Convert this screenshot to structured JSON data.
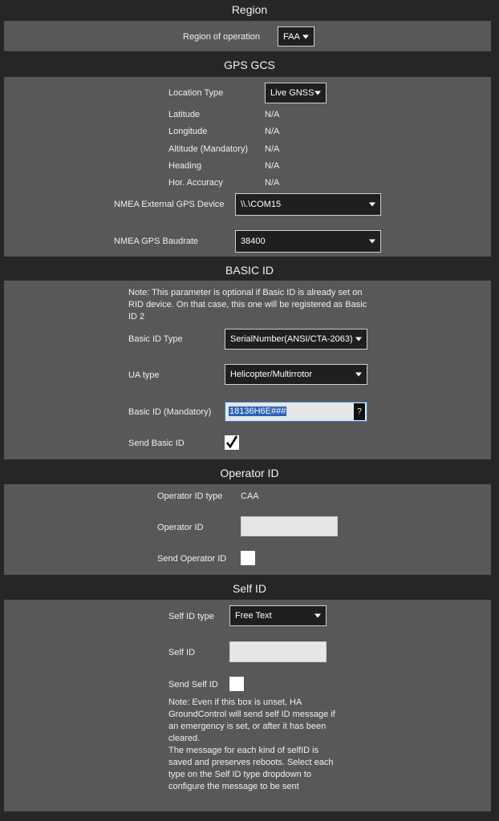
{
  "region": {
    "title": "Region",
    "region_label": "Region of operation",
    "region_value": "FAA"
  },
  "gps": {
    "title": "GPS GCS",
    "location_type_label": "Location Type",
    "location_type_value": "Live GNSS",
    "latitude_label": "Latitude",
    "latitude_value": "N/A",
    "longitude_label": "Longitude",
    "longitude_value": "N/A",
    "altitude_label": "Altitude (Mandatory)",
    "altitude_value": "N/A",
    "heading_label": "Heading",
    "heading_value": "N/A",
    "hacc_label": "Hor. Accuracy",
    "hacc_value": "N/A",
    "nmea_device_label": "NMEA External GPS Device",
    "nmea_device_value": "\\\\.\\COM15",
    "nmea_baud_label": "NMEA GPS Baudrate",
    "nmea_baud_value": "38400"
  },
  "basic_id": {
    "title": "BASIC ID",
    "note": "Note: This parameter is optional if Basic ID is already set on RID device. On that case, this one will be registered as Basic ID 2",
    "type_label": "Basic ID Type",
    "type_value": "SerialNumber(ANSI/CTA-2063)",
    "ua_label": "UA type",
    "ua_value": "Helicopter/Multirrotor",
    "id_label": "Basic ID (Mandatory)",
    "id_value": "18136H6E###",
    "help_label": "?",
    "send_label": "Send Basic ID",
    "send_checked": true
  },
  "operator": {
    "title": "Operator ID",
    "type_label": "Operator ID type",
    "type_value": "CAA",
    "id_label": "Operator ID",
    "id_value": "",
    "send_label": "Send Operator ID",
    "send_checked": false
  },
  "self_id": {
    "title": "Self ID",
    "type_label": "Self ID type",
    "type_value": "Free Text",
    "id_label": "Self ID",
    "id_value": "",
    "send_label": "Send Self ID",
    "send_checked": false,
    "note": "Note: Even if this box is unset, HA GroundControl will send self ID message if an emergency is set, or after it has been cleared.\nThe message for each kind of selfID is saved and preserves reboots. Select each type on the Self ID type dropdown to configure the message to be sent"
  }
}
